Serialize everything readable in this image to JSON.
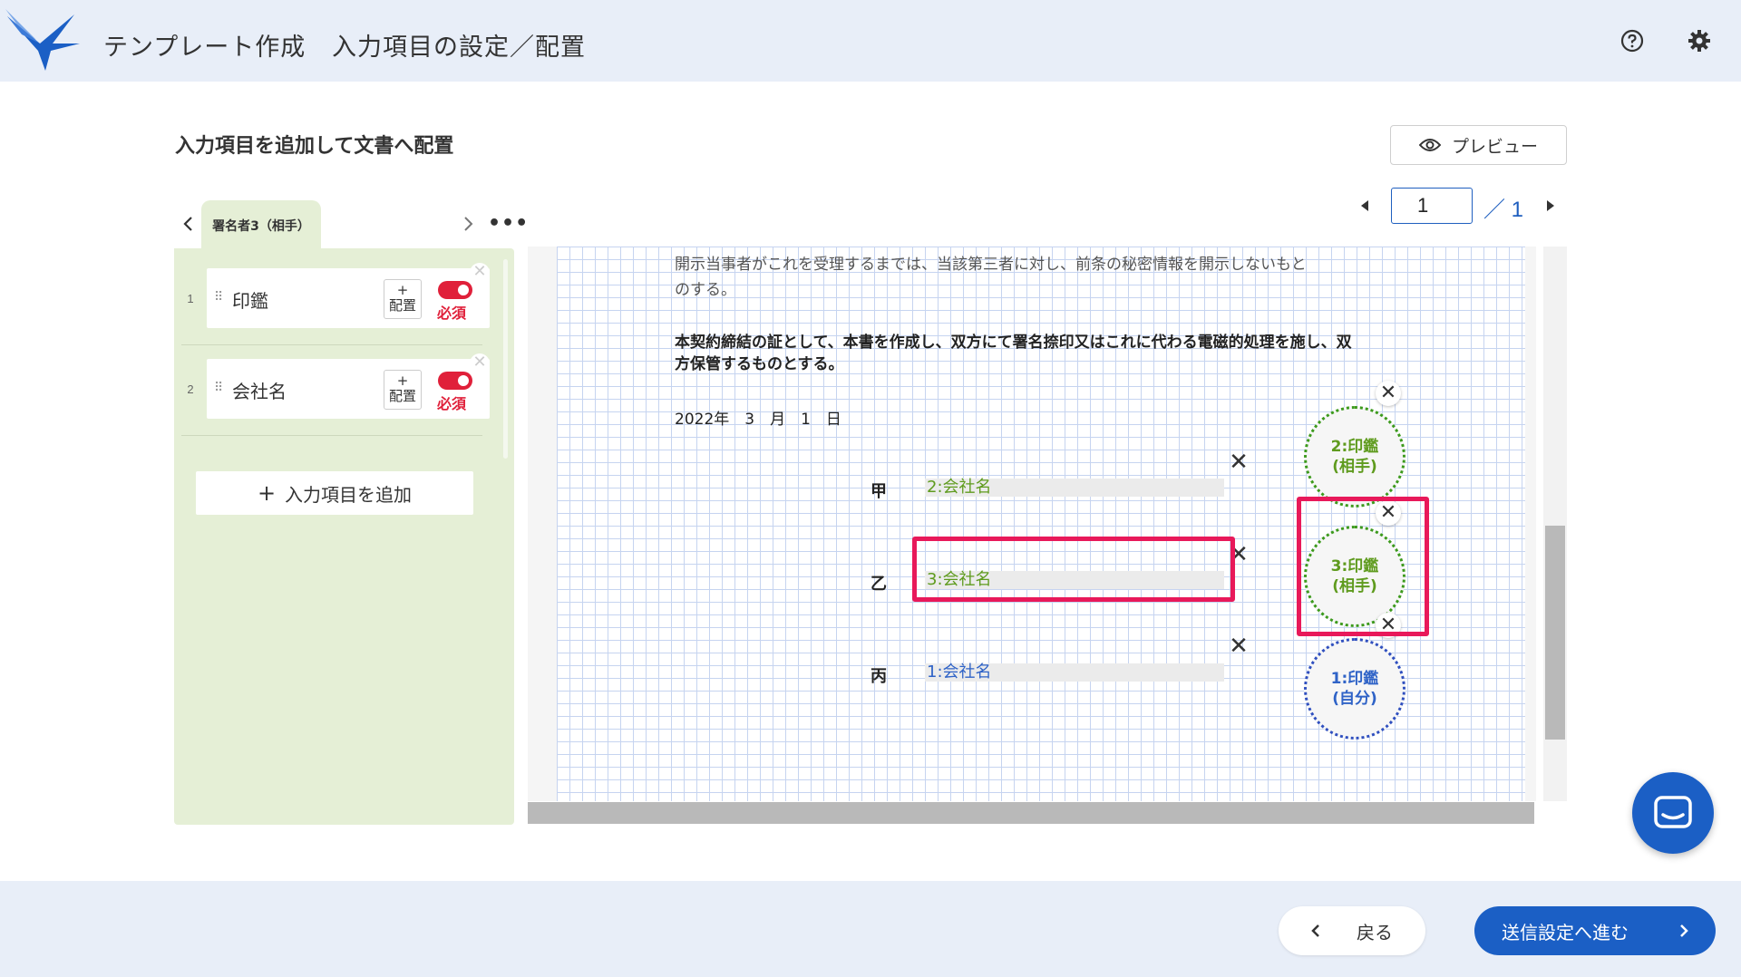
{
  "header": {
    "title": "テンプレート作成",
    "subtitle": "入力項目の設定／配置"
  },
  "main": {
    "heading": "入力項目を追加して文書へ配置",
    "preview_label": "プレビュー"
  },
  "pager": {
    "current": "1",
    "total": "／ 1"
  },
  "signer_tab": {
    "label": "署名者3（相手）"
  },
  "items": [
    {
      "num": "1",
      "label": "印鑑",
      "place_label": "+\n配置",
      "required_label": "必須"
    },
    {
      "num": "2",
      "label": "会社名",
      "place_label": "+\n配置",
      "required_label": "必須"
    }
  ],
  "add_item_label": "入力項目を追加",
  "document": {
    "line1": "開示当事者がこれを受理するまでは、当該第三者に対し、前条の秘密情報を開示しないもと",
    "line2": "のする。",
    "line3": "本契約締結の証として、本書を作成し、双方にて署名捺印又はこれに代わる電磁的処理を施し、双",
    "line4": "方保管するものとする。",
    "date": "2022年　3　月　1　日",
    "parties": [
      {
        "name": "甲",
        "field": "2:会社名"
      },
      {
        "name": "乙",
        "field": "3:会社名"
      },
      {
        "name": "丙",
        "field": "1:会社名"
      }
    ],
    "stamps": [
      {
        "line1": "2:印鑑",
        "line2": "(相手)"
      },
      {
        "line1": "3:印鑑",
        "line2": "(相手)"
      },
      {
        "line1": "1:印鑑",
        "line2": "(自分)"
      }
    ]
  },
  "footer": {
    "back_label": "戻る",
    "next_label": "送信設定へ進む"
  },
  "colors": {
    "accent": "#1b5fc5",
    "highlight": "#e8195a",
    "required": "#e0203a",
    "panel_bg": "#e5efd6",
    "field_green": "#5f9b1e",
    "field_blue": "#2f63c7"
  }
}
